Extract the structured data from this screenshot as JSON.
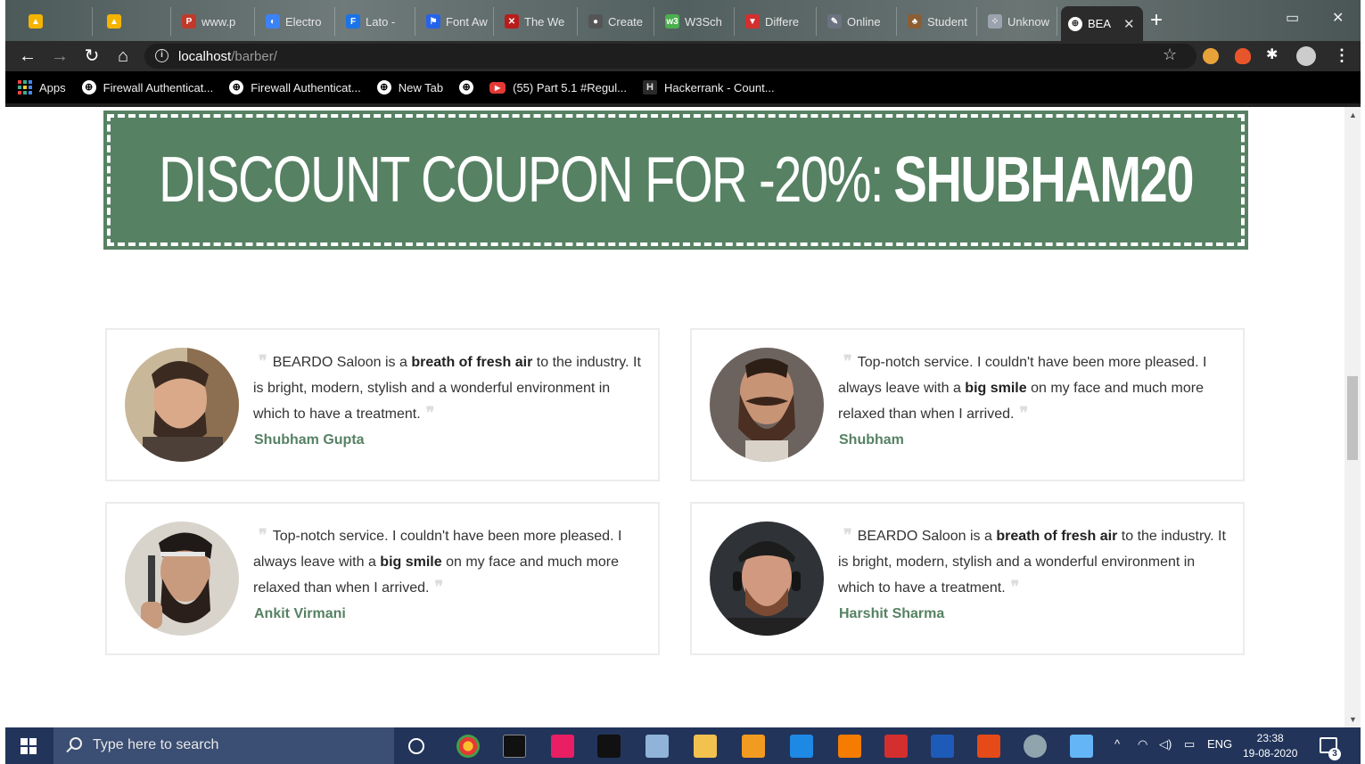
{
  "browser": {
    "tabs": [
      {
        "label": "",
        "color": "#f4b400",
        "glyph": "▲"
      },
      {
        "label": "",
        "color": "#f4b400",
        "glyph": "▲"
      },
      {
        "label": "www.p",
        "color": "#c0392b",
        "glyph": "P"
      },
      {
        "label": "Electro",
        "color": "#3b82f6",
        "glyph": "◐"
      },
      {
        "label": "Lato -",
        "color": "#1a73e8",
        "glyph": "F"
      },
      {
        "label": "Font Aw",
        "color": "#2563eb",
        "glyph": "⚑"
      },
      {
        "label": "The We",
        "color": "#b91c1c",
        "glyph": "✕"
      },
      {
        "label": "Create",
        "color": "#555555",
        "glyph": "●"
      },
      {
        "label": "W3Sch",
        "color": "#4caf50",
        "glyph": "w3"
      },
      {
        "label": "Differe",
        "color": "#d32f2f",
        "glyph": "▼"
      },
      {
        "label": "Online",
        "color": "#6b7280",
        "glyph": "✎"
      },
      {
        "label": "Student",
        "color": "#8b5e34",
        "glyph": "♣"
      },
      {
        "label": "Unknow",
        "color": "#9ca3af",
        "glyph": "⁘"
      }
    ],
    "active_tab": {
      "label": "BEA",
      "close": "✕"
    },
    "new_tab": "+",
    "address": {
      "host": "localhost",
      "path": "/barber/"
    },
    "bookmarks": [
      {
        "label": "Apps"
      },
      {
        "label": "Firewall Authenticat..."
      },
      {
        "label": "Firewall Authenticat..."
      },
      {
        "label": "New Tab"
      },
      {
        "label": ""
      },
      {
        "label": "(55) Part 5.1 #Regul..."
      },
      {
        "label": "Hackerrank - Count..."
      }
    ]
  },
  "coupon": {
    "text": "DISCOUNT COUPON FOR -20%:",
    "code": "SHUBHAM20",
    "bg_color": "#568163"
  },
  "testimonials": [
    {
      "before": "BEARDO Saloon is a ",
      "bold": "breath of fresh air",
      "after": " to the industry. It is bright, modern, stylish and a wonderful environment in which to have a treatment.",
      "author": "Shubham Gupta"
    },
    {
      "before": "Top-notch service. I couldn't have been more pleased. I always leave with a ",
      "bold": "big smile",
      "after": " on my face and much more relaxed than when I arrived.",
      "author": "Shubham"
    },
    {
      "before": "Top-notch service. I couldn't have been more pleased. I always leave with a ",
      "bold": "big smile",
      "after": " on my face and much more relaxed than when I arrived.",
      "author": "Ankit Virmani"
    },
    {
      "before": "BEARDO Saloon is a ",
      "bold": "breath of fresh air",
      "after": " to the industry. It is bright, modern, stylish and a wonderful environment in which to have a treatment.",
      "author": "Harshit Sharma"
    }
  ],
  "quote_glyph": "❞",
  "taskbar": {
    "search_placeholder": "Type here to search",
    "tray_lang": "ENG",
    "time": "23:38",
    "date": "19-08-2020",
    "notifications": "3"
  }
}
